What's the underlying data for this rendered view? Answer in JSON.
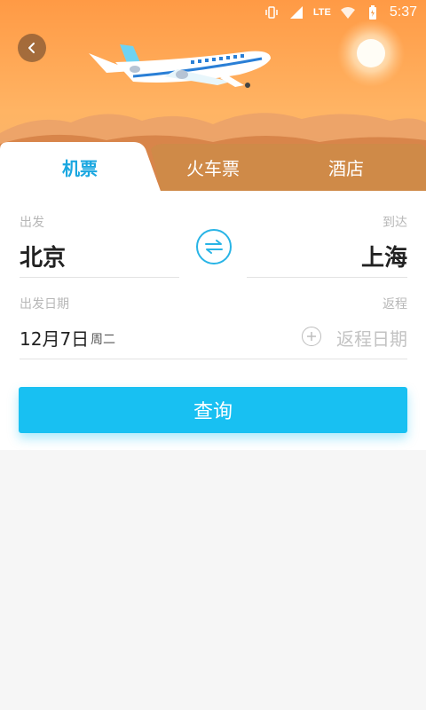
{
  "status_bar": {
    "time": "5:37",
    "network": "LTE",
    "icons": [
      "vibrate-icon",
      "signal-icon",
      "wifi-icon",
      "battery-icon"
    ]
  },
  "nav": {
    "back_icon": "chevron-left-icon"
  },
  "tabs": [
    {
      "label": "机票",
      "active": true
    },
    {
      "label": "火车票",
      "active": false
    },
    {
      "label": "酒店",
      "active": false
    }
  ],
  "form": {
    "departure": {
      "label": "出发",
      "city": "北京"
    },
    "arrival": {
      "label": "到达",
      "city": "上海"
    },
    "swap_icon": "swap-arrows-icon",
    "departure_date": {
      "label": "出发日期",
      "date": "12月7日",
      "weekday": "周二"
    },
    "return_date": {
      "label": "返程",
      "placeholder": "返程日期",
      "add_icon": "plus-circle-icon"
    },
    "search_button": "查询"
  },
  "colors": {
    "accent": "#1aa7e0",
    "button": "#18c0f2",
    "hero_sky": "#ff9a45"
  }
}
